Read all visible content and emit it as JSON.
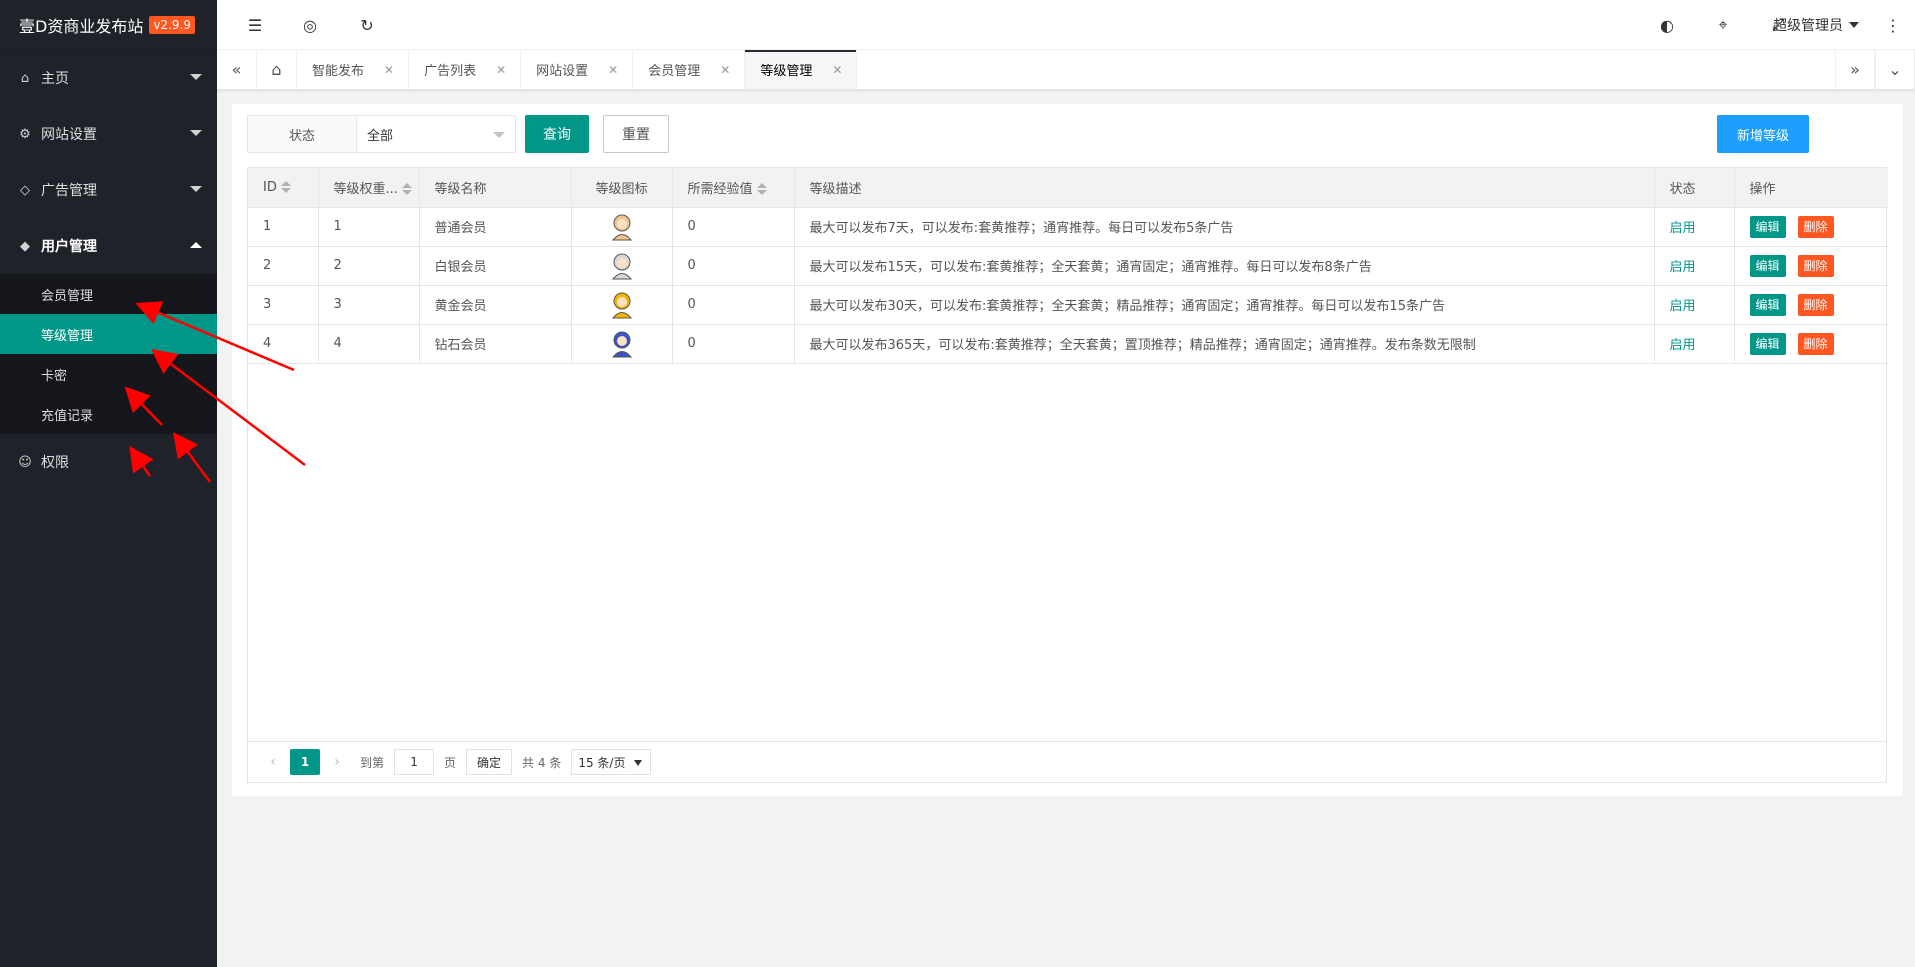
{
  "app": {
    "title": "壹D资商业发布站",
    "version": "v2.9.9"
  },
  "sidebar": {
    "items": [
      {
        "label": "主页",
        "icon": "home-icon"
      },
      {
        "label": "网站设置",
        "icon": "settings-icon"
      },
      {
        "label": "广告管理",
        "icon": "diamond-icon"
      },
      {
        "label": "用户管理",
        "icon": "diamond-icon"
      },
      {
        "label": "权限",
        "icon": "user-icon"
      }
    ],
    "sub_items": [
      "会员管理",
      "等级管理",
      "卡密",
      "充值记录"
    ]
  },
  "header": {
    "admin": "超级管理员"
  },
  "tabs": [
    "智能发布",
    "广告列表",
    "网站设置",
    "会员管理",
    "等级管理"
  ],
  "filter": {
    "label": "状态",
    "value": "全部",
    "query": "查询",
    "reset": "重置",
    "add": "新增等级"
  },
  "table": {
    "headers": [
      "ID",
      "等级权重...",
      "等级名称",
      "等级图标",
      "所需经验值",
      "等级描述",
      "状态",
      "操作"
    ],
    "rows": [
      {
        "id": "1",
        "weight": "1",
        "name": "普通会员",
        "exp": "0",
        "desc": "最大可以发布7天，可以发布:套黄推荐；通宵推荐。每日可以发布5条广告",
        "status": "启用",
        "icon_color": "#f2c48d"
      },
      {
        "id": "2",
        "weight": "2",
        "name": "白银会员",
        "exp": "0",
        "desc": "最大可以发布15天，可以发布:套黄推荐；全天套黄；通宵固定；通宵推荐。每日可以发布8条广告",
        "status": "启用",
        "icon_color": "#d8d8d8"
      },
      {
        "id": "3",
        "weight": "3",
        "name": "黄金会员",
        "exp": "0",
        "desc": "最大可以发布30天，可以发布:套黄推荐；全天套黄；精品推荐；通宵固定；通宵推荐。每日可以发布15条广告",
        "status": "启用",
        "icon_color": "#f5b400"
      },
      {
        "id": "4",
        "weight": "4",
        "name": "钻石会员",
        "exp": "0",
        "desc": "最大可以发布365天，可以发布:套黄推荐；全天套黄；置顶推荐；精品推荐；通宵固定；通宵推荐。发布条数无限制",
        "status": "启用",
        "icon_color": "#3a55c8"
      }
    ],
    "actions": {
      "edit": "编辑",
      "delete": "删除"
    }
  },
  "pager": {
    "current": "1",
    "goto_label": "到第",
    "page_input": "1",
    "page_label": "页",
    "confirm": "确定",
    "total": "共 4 条",
    "size": "15 条/页"
  }
}
